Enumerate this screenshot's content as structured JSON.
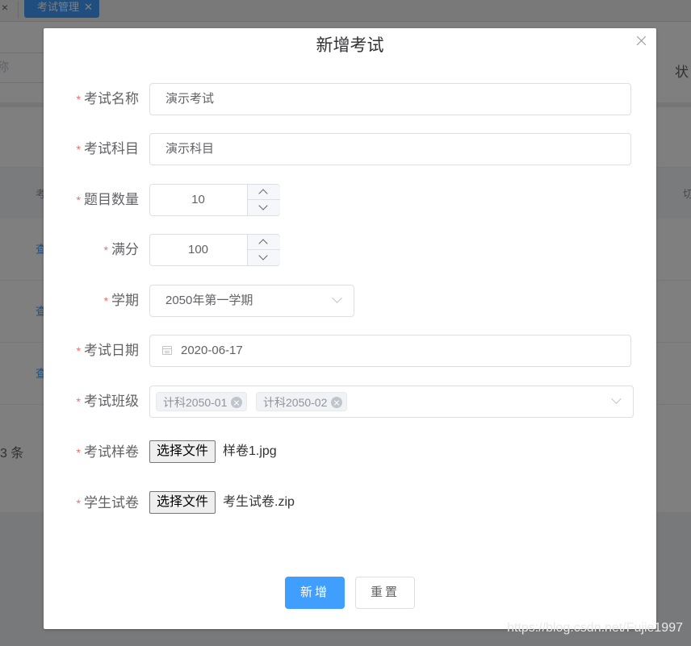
{
  "background": {
    "tab": {
      "label": "考试管理"
    },
    "search_placeholder_fragment": "称",
    "status_label_fragment": "状",
    "table": {
      "col1_fragment": "考",
      "col2_fragment": "切",
      "row_link_fragment": "查"
    },
    "total_fragment": "3 条"
  },
  "dialog": {
    "title": "新增考试",
    "fields": {
      "exam_name": {
        "label": "考试名称",
        "value": "演示考试"
      },
      "exam_subject": {
        "label": "考试科目",
        "value": "演示科目"
      },
      "question_count": {
        "label": "题目数量",
        "value": "10"
      },
      "full_score": {
        "label": "满分",
        "value": "100"
      },
      "semester": {
        "label": "学期",
        "value": "2050年第一学期"
      },
      "exam_date": {
        "label": "考试日期",
        "value": "2020-06-17"
      },
      "exam_classes": {
        "label": "考试班级",
        "tags": [
          "计科2050-01",
          "计科2050-02"
        ]
      },
      "sample_paper": {
        "label": "考试样卷",
        "button": "选择文件",
        "file": "样卷1.jpg"
      },
      "student_paper": {
        "label": "学生试卷",
        "button": "选择文件",
        "file": "考生试卷.zip"
      }
    },
    "required_mark": "*",
    "buttons": {
      "submit": "新增",
      "reset": "重置"
    }
  },
  "watermark": "https://blog.csdn.net/Fujie1997",
  "colors": {
    "primary": "#409eff",
    "required": "#f56c6c",
    "mask": "rgba(0,0,0,0.5)"
  }
}
